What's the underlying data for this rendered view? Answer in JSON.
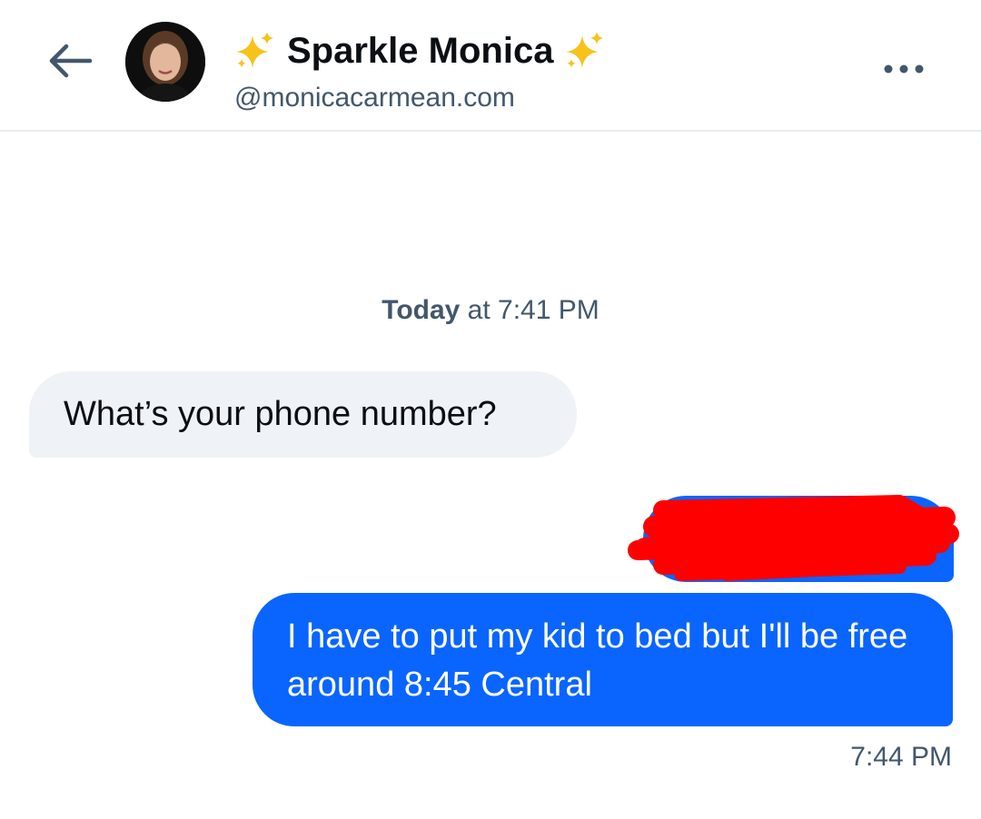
{
  "header": {
    "display_name_emoji_left": "✨",
    "display_name": "Sparkle Monica",
    "display_name_emoji_right": "✨",
    "handle": "@monicacarmean.com",
    "back_icon": "arrow-left-icon",
    "more_icon": "ellipsis-icon"
  },
  "conversation": {
    "date_label_bold": "Today",
    "date_label_rest": " at 7:41 PM",
    "messages": [
      {
        "direction": "incoming",
        "text": "What’s your phone number?"
      },
      {
        "direction": "outgoing",
        "text": "",
        "redacted": true
      },
      {
        "direction": "outgoing",
        "text": "I have to put my kid to bed but I'll be free around 8:45 Central"
      }
    ],
    "last_time": "7:44 PM"
  },
  "colors": {
    "outgoing_bubble": "#0a65fe",
    "incoming_bubble": "#eff2f6",
    "redaction": "#ff0000",
    "muted_text": "#42576c"
  }
}
